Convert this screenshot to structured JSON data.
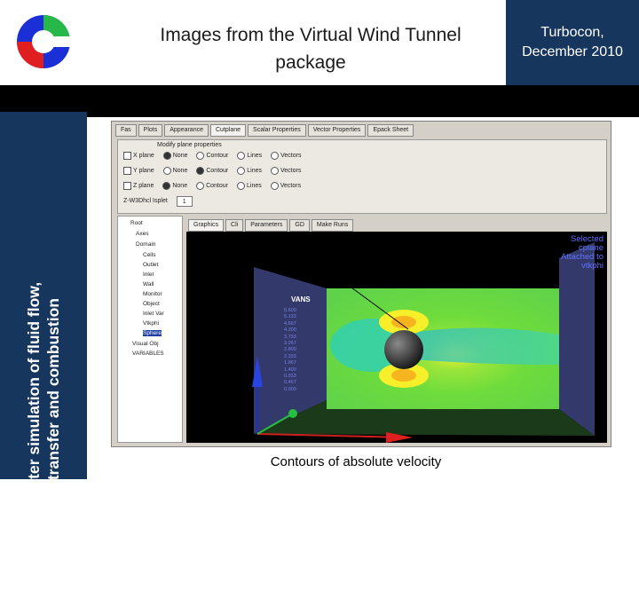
{
  "header": {
    "title_line1": "Images from the  Virtual Wind Tunnel",
    "title_line2": "package",
    "corner_line1": "Turbocon,",
    "corner_line2": "December 2010",
    "logo_icon": "turbocon-c-logo"
  },
  "sidebar": {
    "line1": "Computer simulation of fluid flow,",
    "line2": "heat transfer and combustion"
  },
  "screenshot": {
    "top_tabs": [
      "Fas",
      "Plots",
      "Appearance",
      "Cutplane",
      "Scalar Properties",
      "Vector Properties",
      "Epack Sheet"
    ],
    "panel_title": "Modify plane properties",
    "rows": [
      {
        "axis": "X plane",
        "options": [
          "None",
          "Contour",
          "Lines",
          "Vectors"
        ]
      },
      {
        "axis": "Y plane",
        "options": [
          "None",
          "Contour",
          "Lines",
          "Vectors"
        ]
      },
      {
        "axis": "Z plane",
        "options": [
          "None",
          "Contour",
          "Lines",
          "Vectors"
        ]
      }
    ],
    "bottom_row_text": "Z-W3Dhcl Isplet",
    "bottom_row_value": "1",
    "tree_items": [
      "Root",
      "Axes",
      "Domain",
      "Cells",
      "Outlet",
      "Inlet",
      "Wall",
      "Monitor",
      "Object",
      "Inlet Var",
      "Vtkphi",
      "Sphere",
      "Visual Obj",
      "VARIABLES"
    ],
    "view_tabs": [
      "Graphics",
      "Cli",
      "Parameters",
      "GD",
      "Make Runs"
    ],
    "overlay_line1": "Selected",
    "overlay_line2": "cplane",
    "overlay_line3": "Attached to",
    "overlay_line4": "vtkphi",
    "legend_title": "VANS",
    "legend_values": [
      "5.600",
      "5.133",
      "4.667",
      "4.200",
      "3.733",
      "3.267",
      "2.800",
      "2.333",
      "1.867",
      "1.400",
      "0.933",
      "0.467",
      "0.000"
    ]
  },
  "caption": "Contours of absolute velocity",
  "colors": {
    "navy": "#17365d",
    "bar": "#000000",
    "logo_blue": "#1a2fd6",
    "logo_red": "#e02020",
    "logo_green": "#27b84a"
  }
}
